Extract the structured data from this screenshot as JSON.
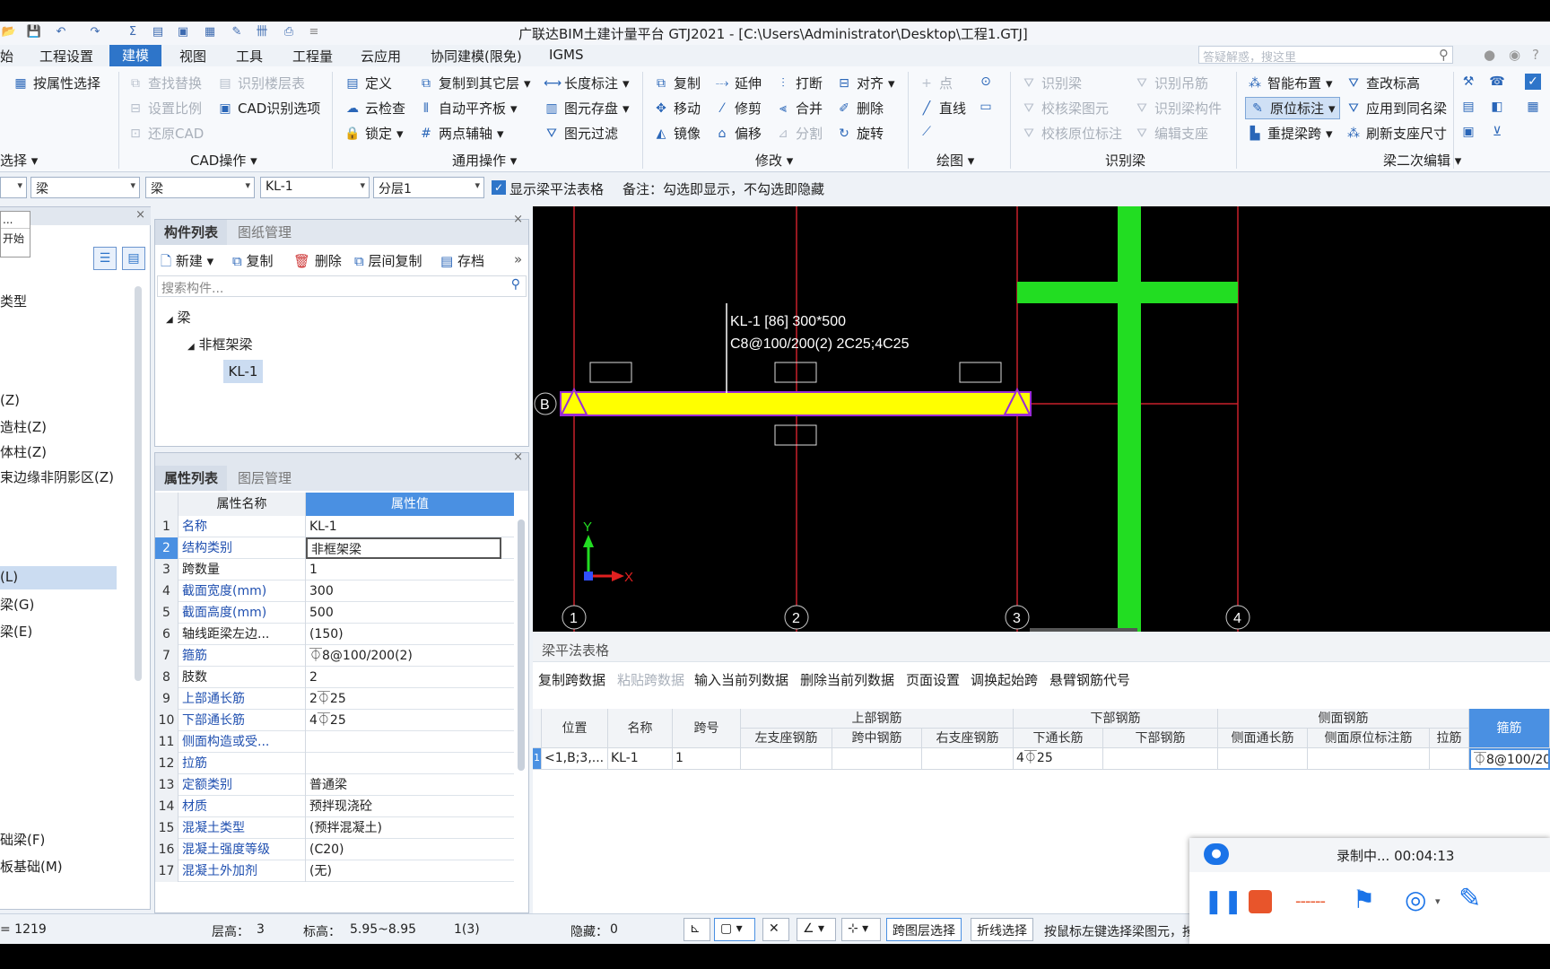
{
  "title": "广联达BIM土建计量平台 GTJ2021 - [C:\\Users\\Administrator\\Desktop\\工程1.GTJ]",
  "menu": [
    "始",
    "工程设置",
    "建模",
    "视图",
    "工具",
    "工程量",
    "云应用",
    "协同建模(限免)",
    "IGMS"
  ],
  "search_placeholder": "答疑解惑，搜这里",
  "ribbon": {
    "select_group": {
      "by_attr": "按属性选择",
      "group_label": "选择"
    },
    "cad_ops": {
      "find_replace": "查找替换",
      "identify_floor_table": "识别楼层表",
      "set_scale": "设置比例",
      "cad_options": "CAD识别选项",
      "restore_cad": "还原CAD",
      "group_label": "CAD操作"
    },
    "general_ops": {
      "define": "定义",
      "copy_to_floors": "复制到其它层",
      "length_dim": "长度标注",
      "cloud_check": "云检查",
      "auto_flush": "自动平齐板",
      "element_save": "图元存盘",
      "lock": "锁定",
      "two_point_axis": "两点辅轴",
      "element_filter": "图元过滤",
      "group_label": "通用操作"
    },
    "modify": {
      "copy": "复制",
      "extend": "延伸",
      "break": "打断",
      "align": "对齐",
      "move": "移动",
      "trim": "修剪",
      "merge": "合并",
      "delete": "删除",
      "mirror": "镜像",
      "offset": "偏移",
      "split": "分割",
      "rotate": "旋转",
      "group_label": "修改"
    },
    "draw": {
      "point": "点",
      "line": "直线",
      "group_label": "绘图"
    },
    "identify_beam": {
      "identify": "识别梁",
      "identify_hanger": "识别吊筋",
      "verify_beam": "校核梁图元",
      "identify_member": "识别梁构件",
      "verify_orig": "校核原位标注",
      "edit_support": "编辑支座",
      "group_label": "识别梁"
    },
    "beam_edit": {
      "smart_layout": "智能布置",
      "check_elev": "查改标高",
      "orig_mark": "原位标注",
      "apply_same": "应用到同名梁",
      "re_span": "重提梁跨",
      "refresh_support": "刷新支座尺寸",
      "group_label": "梁二次编辑"
    }
  },
  "filter": {
    "sel1": "梁",
    "sel2": "梁",
    "sel3": "KL-1",
    "sel4": "分层1",
    "show_table": "显示梁平法表格",
    "note": "备注：勾选即显示，不勾选即隐藏"
  },
  "left_nav": {
    "tooltip1": "...",
    "tooltip2": "开始",
    "items": [
      "类型",
      "(Z)",
      "造柱(Z)",
      "体柱(Z)",
      "束边缘非阴影区(Z)",
      "(L)",
      "梁(G)",
      "梁(E)",
      "础梁(F)",
      "板基础(M)"
    ]
  },
  "component_panel": {
    "tabs": [
      "构件列表",
      "图纸管理"
    ],
    "toolbar": [
      "新建",
      "复制",
      "删除",
      "层间复制",
      "存档"
    ],
    "search_placeholder": "搜索构件...",
    "tree": {
      "root": "梁",
      "child": "非框架梁",
      "leaf": "KL-1"
    }
  },
  "property_panel": {
    "tabs": [
      "属性列表",
      "图层管理"
    ],
    "headers": [
      "属性名称",
      "属性值"
    ],
    "rows": [
      {
        "n": "1",
        "k": "名称",
        "v": "KL-1"
      },
      {
        "n": "2",
        "k": "结构类别",
        "v": "非框架梁"
      },
      {
        "n": "3",
        "k": "跨数量",
        "v": "1"
      },
      {
        "n": "4",
        "k": "截面宽度(mm)",
        "v": "300"
      },
      {
        "n": "5",
        "k": "截面高度(mm)",
        "v": "500"
      },
      {
        "n": "6",
        "k": "轴线距梁左边...",
        "v": "(150)"
      },
      {
        "n": "7",
        "k": "箍筋",
        "v": "⏁8@100/200(2)"
      },
      {
        "n": "8",
        "k": "肢数",
        "v": "2"
      },
      {
        "n": "9",
        "k": "上部通长筋",
        "v": "2⏁25"
      },
      {
        "n": "10",
        "k": "下部通长筋",
        "v": "4⏁25"
      },
      {
        "n": "11",
        "k": "侧面构造或受...",
        "v": ""
      },
      {
        "n": "12",
        "k": "拉筋",
        "v": ""
      },
      {
        "n": "13",
        "k": "定额类别",
        "v": "普通梁"
      },
      {
        "n": "14",
        "k": "材质",
        "v": "预拌现浇砼"
      },
      {
        "n": "15",
        "k": "混凝土类型",
        "v": "(预拌混凝土)"
      },
      {
        "n": "16",
        "k": "混凝土强度等级",
        "v": "(C20)"
      },
      {
        "n": "17",
        "k": "混凝土外加剂",
        "v": "(无)"
      }
    ]
  },
  "canvas": {
    "beam_label1": "KL-1 [86] 300*500",
    "beam_label2": "C8@100/200(2) 2C25;4C25",
    "axis_b": "B",
    "axes": [
      "1",
      "2",
      "3",
      "4"
    ],
    "ucs_x": "X",
    "ucs_y": "Y"
  },
  "table_panel": {
    "title": "梁平法表格",
    "toolbar": [
      "复制跨数据",
      "粘贴跨数据",
      "输入当前列数据",
      "删除当前列数据",
      "页面设置",
      "调换起始跨",
      "悬臂钢筋代号"
    ],
    "h_groups": [
      "上部钢筋",
      "下部钢筋",
      "侧面钢筋"
    ],
    "h": [
      "位置",
      "名称",
      "跨号",
      "左支座钢筋",
      "跨中钢筋",
      "右支座钢筋",
      "下通长筋",
      "下部钢筋",
      "侧面通长筋",
      "侧面原位标注筋",
      "拉筋",
      "箍筋"
    ],
    "row": {
      "idx": "1",
      "pos": "<1,B;3,...",
      "name": "KL-1",
      "span": "1",
      "bottom_through": "4⏁25",
      "stirrup": "⏁8@100/20"
    }
  },
  "status": {
    "coord": "= 1219",
    "floor_h": "层高：",
    "floor_h_v": "3",
    "elev": "标高：",
    "elev_v": "5.95~8.95",
    "page": "1(3)",
    "hidden": "隐藏：",
    "hidden_v": "0",
    "cross_layer": "跨图层选择",
    "poly_select": "折线选择",
    "hint": "按鼠标左键选择梁图元，按右键或 ESC 退出；可以通过回车键及 Shift+\\\"→←↑\\\" 光"
  },
  "recorder": {
    "text": "录制中... 00:04:13"
  },
  "colors": {
    "accent": "#2e75c9",
    "beam": "#ffff00",
    "column": "#22dd22",
    "grid": "#c8202a"
  }
}
